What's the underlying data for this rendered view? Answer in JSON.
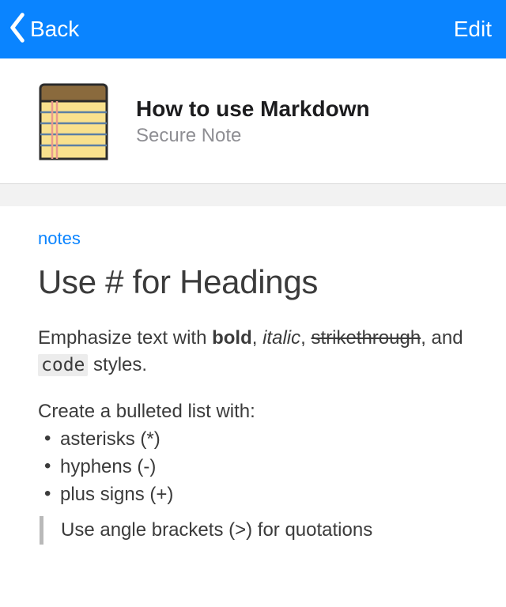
{
  "nav": {
    "back_label": "Back",
    "edit_label": "Edit"
  },
  "header": {
    "title": "How to use Markdown",
    "subtitle": "Secure Note"
  },
  "section_label": "notes",
  "heading": "Use # for Headings",
  "emphasis": {
    "pre": "Emphasize text with ",
    "bold": "bold",
    "comma1": ", ",
    "italic": "italic",
    "comma2": ", ",
    "strike": "strikethrough",
    "and": ", and ",
    "code": "code",
    "post": " styles."
  },
  "list_intro": "Create a bulleted list with:",
  "bullets": {
    "0": "asterisks (*)",
    "1": "hyphens (-)",
    "2": "plus signs (+)"
  },
  "quote_text": "Use angle brackets (>) for quotations"
}
